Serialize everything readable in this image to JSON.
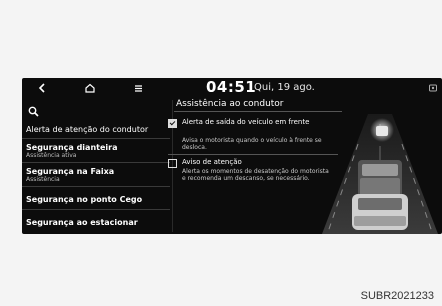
{
  "header": {
    "time": "04:51",
    "date": "Qui, 19 ago."
  },
  "sidebar": {
    "items": [
      {
        "label": "Alerta de atenção do condutor",
        "sub": ""
      },
      {
        "label": "Segurança dianteira",
        "sub": "Assistência ativa"
      },
      {
        "label": "Segurança na Faixa",
        "sub": "Assistência"
      },
      {
        "label": "Segurança no ponto Cego",
        "sub": ""
      },
      {
        "label": "Segurança ao estacionar",
        "sub": ""
      }
    ]
  },
  "panel": {
    "title": "Assistência ao condutor",
    "options": [
      {
        "title": "Alerta de saída do veículo em frente",
        "desc": "Avisa o motorista quando o veículo à frente se desloca.",
        "checked": true
      },
      {
        "title": "Aviso de atenção",
        "desc": "Alerta os momentos de desatenção do motorista e recomenda um descanso, se necessário.",
        "checked": false
      }
    ]
  },
  "icons": {
    "back": "back-icon",
    "home": "home-icon",
    "menu": "menu-icon",
    "search": "search-icon",
    "settings": "settings-icon"
  },
  "caption": "SUBR2021233"
}
